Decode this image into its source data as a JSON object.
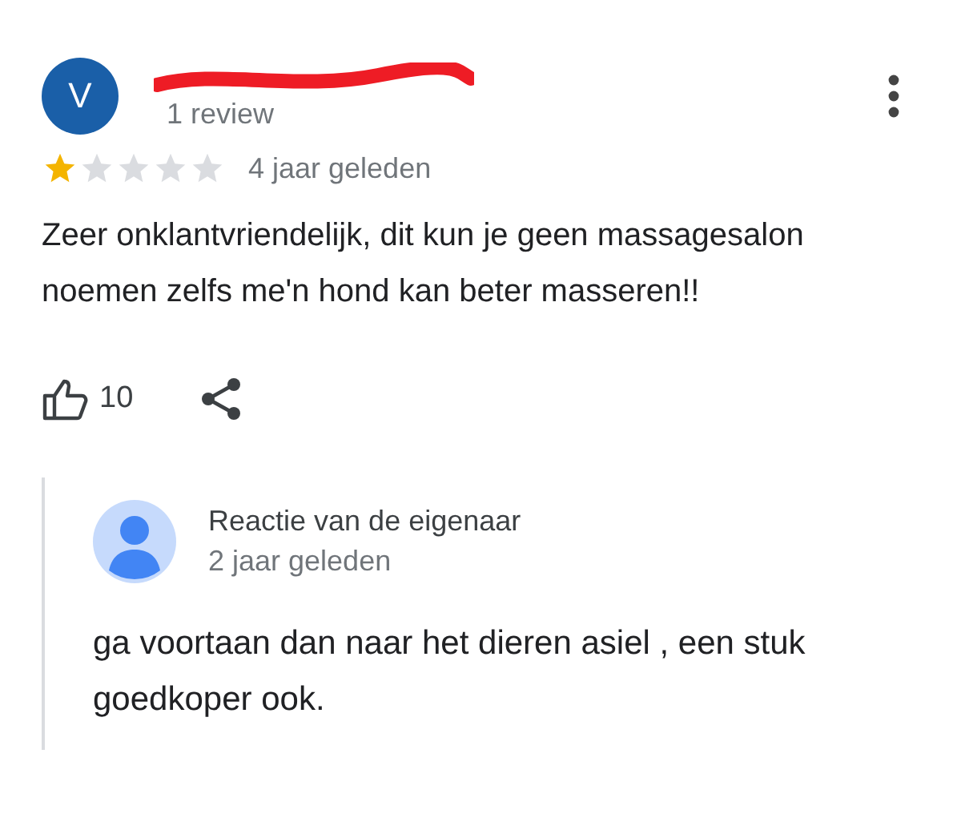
{
  "review": {
    "avatar_letter": "V",
    "review_count": "1 review",
    "stars": 1,
    "time": "4 jaar geleden",
    "text": "Zeer onklantvriendelijk, dit kun je geen massagesalon noemen zelfs me'n hond kan beter masseren!!",
    "likes": "10"
  },
  "owner_reply": {
    "author": "Reactie van de eigenaar",
    "time": "2 jaar geleden",
    "text": "ga voortaan dan naar het dieren asiel , een stuk goedkoper ook."
  }
}
